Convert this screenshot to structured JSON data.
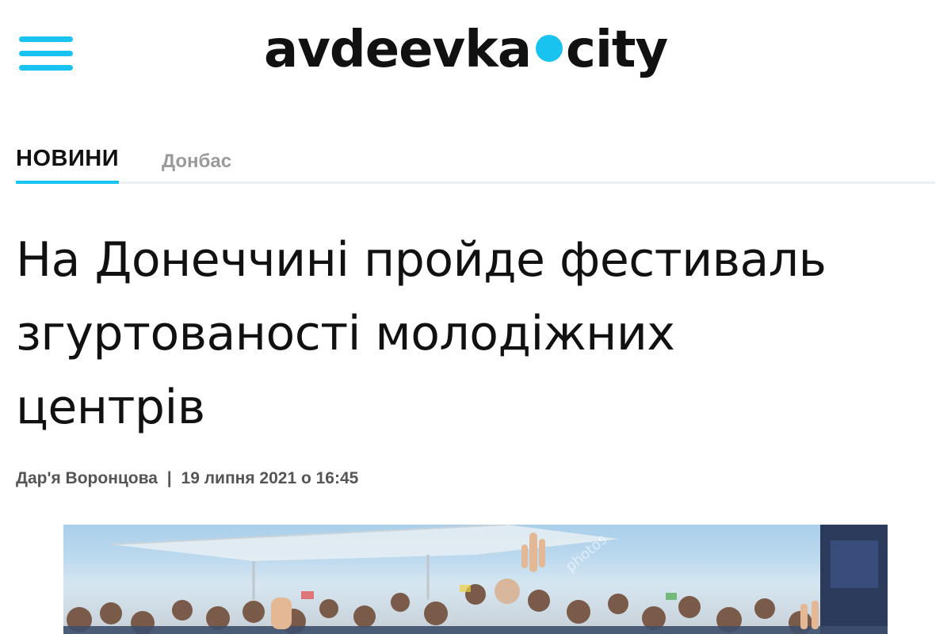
{
  "header": {
    "logo_left": "avdeevka",
    "logo_right": "city",
    "menu_icon": "hamburger-menu-icon",
    "accent_color": "#19c3f0"
  },
  "rubrics": {
    "main": "НОВИНИ",
    "sub": "Донбас"
  },
  "article": {
    "title_lines": [
      "На Донеччині пройде фестиваль",
      "згуртованості молодіжних",
      "центрів"
    ],
    "author": "Дар'я Воронцова",
    "separator": "|",
    "date": "19 липня 2021 о 16:45",
    "photo_watermark": "photos"
  }
}
